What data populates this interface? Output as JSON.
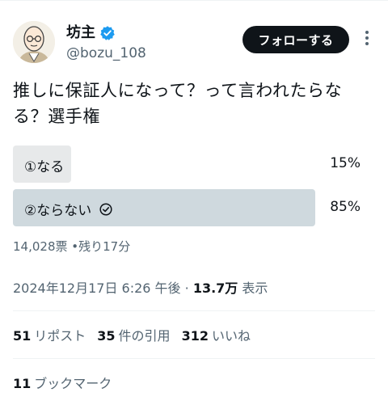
{
  "author": {
    "name": "坊主",
    "handle": "@bozu_108",
    "follow_label": "フォローする"
  },
  "tweet": {
    "text": "推しに保証人になって？って言われたらなる？選手権"
  },
  "poll": {
    "options": [
      {
        "label": "①なる",
        "percent": "15%",
        "fill": 0.15,
        "winner": false
      },
      {
        "label": "②ならない",
        "percent": "85%",
        "fill": 0.85,
        "winner": true
      }
    ],
    "votes": "14,028票",
    "separator": "•",
    "remaining": "残り17分"
  },
  "meta": {
    "datetime": "2024年12月17日 6:26 午後",
    "dot": "·",
    "views": "13.7万",
    "views_label": "表示"
  },
  "stats": {
    "reposts": "51",
    "reposts_label": "リポスト",
    "quotes": "35",
    "quotes_label": "件の引用",
    "likes": "312",
    "likes_label": "いいね",
    "bookmarks": "11",
    "bookmarks_label": "ブックマーク"
  },
  "colors": {
    "verified": "#1d9bf0",
    "follow_bg": "#0f1419",
    "bar_winner": "#cfd9de",
    "bar_loser": "#e7e9ea",
    "secondary_text": "#536471"
  }
}
